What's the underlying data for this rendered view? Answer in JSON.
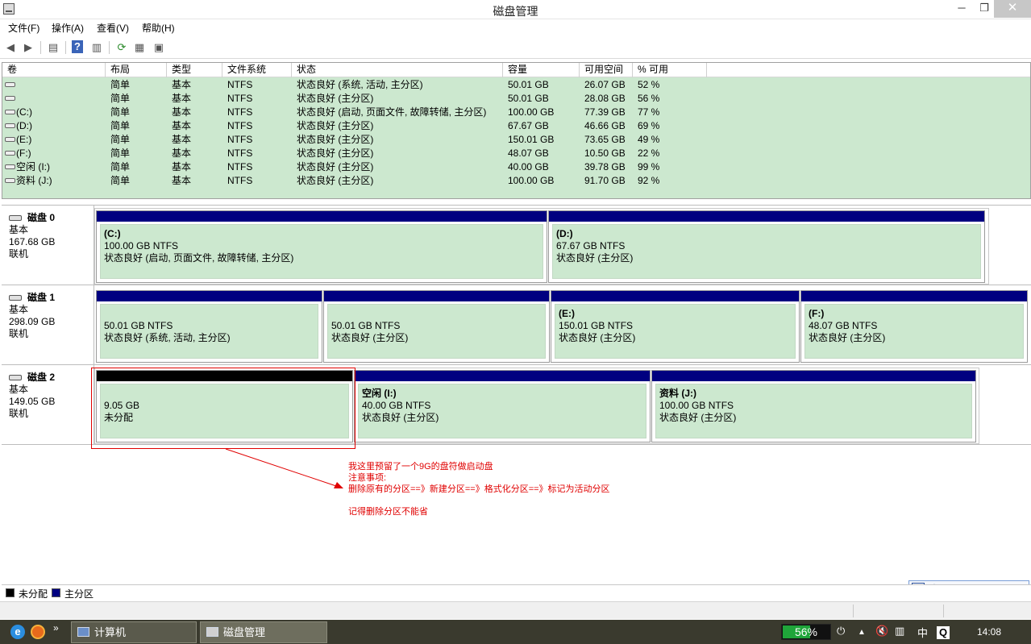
{
  "window": {
    "title": "磁盘管理"
  },
  "menu": [
    "文件(F)",
    "操作(A)",
    "查看(V)",
    "帮助(H)"
  ],
  "toolbar": {
    "buttons": [
      "back-icon",
      "forward-icon",
      "show-hide-console-tree-icon",
      "help-icon",
      "show-hide-action-pane-icon",
      "refresh-icon",
      "properties-icon",
      "rescan-disks-icon"
    ]
  },
  "volume_list": {
    "columns": [
      "卷",
      "布局",
      "类型",
      "文件系统",
      "状态",
      "容量",
      "可用空间",
      "% 可用"
    ],
    "rows": [
      [
        "",
        "简单",
        "基本",
        "NTFS",
        "状态良好 (系统, 活动, 主分区)",
        "50.01 GB",
        "26.07 GB",
        "52 %"
      ],
      [
        "",
        "简单",
        "基本",
        "NTFS",
        "状态良好 (主分区)",
        "50.01 GB",
        "28.08 GB",
        "56 %"
      ],
      [
        "(C:)",
        "简单",
        "基本",
        "NTFS",
        "状态良好 (启动, 页面文件, 故障转储, 主分区)",
        "100.00 GB",
        "77.39 GB",
        "77 %"
      ],
      [
        "(D:)",
        "简单",
        "基本",
        "NTFS",
        "状态良好 (主分区)",
        "67.67 GB",
        "46.66 GB",
        "69 %"
      ],
      [
        "(E:)",
        "简单",
        "基本",
        "NTFS",
        "状态良好 (主分区)",
        "150.01 GB",
        "73.65 GB",
        "49 %"
      ],
      [
        "(F:)",
        "简单",
        "基本",
        "NTFS",
        "状态良好 (主分区)",
        "48.07 GB",
        "10.50 GB",
        "22 %"
      ],
      [
        "空闲 (I:)",
        "简单",
        "基本",
        "NTFS",
        "状态良好 (主分区)",
        "40.00 GB",
        "39.78 GB",
        "99 %"
      ],
      [
        "资料 (J:)",
        "简单",
        "基本",
        "NTFS",
        "状态良好 (主分区)",
        "100.00 GB",
        "91.70 GB",
        "92 %"
      ]
    ]
  },
  "disks": [
    {
      "name": "磁盘 0",
      "type": "基本",
      "size": "167.68 GB",
      "status": "联机",
      "partitions": [
        {
          "name": "(C:)",
          "size": "100.00 GB NTFS",
          "status": "状态良好 (启动, 页面文件, 故障转储, 主分区)",
          "kind": "primary"
        },
        {
          "name": "(D:)",
          "size": "67.67 GB NTFS",
          "status": "状态良好 (主分区)",
          "kind": "primary"
        }
      ]
    },
    {
      "name": "磁盘 1",
      "type": "基本",
      "size": "298.09 GB",
      "status": "联机",
      "partitions": [
        {
          "name": "",
          "size": "50.01 GB NTFS",
          "status": "状态良好 (系统, 活动, 主分区)",
          "kind": "primary"
        },
        {
          "name": "",
          "size": "50.01 GB NTFS",
          "status": "状态良好 (主分区)",
          "kind": "primary"
        },
        {
          "name": "(E:)",
          "size": "150.01 GB NTFS",
          "status": "状态良好 (主分区)",
          "kind": "primary"
        },
        {
          "name": "(F:)",
          "size": "48.07 GB NTFS",
          "status": "状态良好 (主分区)",
          "kind": "primary"
        }
      ]
    },
    {
      "name": "磁盘 2",
      "type": "基本",
      "size": "149.05 GB",
      "status": "联机",
      "partitions": [
        {
          "name": "",
          "size": "9.05 GB",
          "status": "未分配",
          "kind": "unallocated"
        },
        {
          "name": "空闲  (I:)",
          "size": "40.00 GB NTFS",
          "status": "状态良好 (主分区)",
          "kind": "primary"
        },
        {
          "name": "资料  (J:)",
          "size": "100.00 GB NTFS",
          "status": "状态良好 (主分区)",
          "kind": "primary"
        }
      ]
    }
  ],
  "annotation": [
    "我这里预留了一个9G的盘符做启动盘",
    "注意事项:",
    "删除原有的分区==》新建分区==》格式化分区==》标记为活动分区",
    "",
    "记得删除分区不能省"
  ],
  "legend": [
    {
      "label": "未分配",
      "color": "#000000"
    },
    {
      "label": "主分区",
      "color": "#000080"
    }
  ],
  "ime_bar": {
    "items": [
      "中",
      "☽",
      "°,",
      "⌨",
      "⁝",
      "🔧"
    ]
  },
  "taskbar": {
    "buttons": [
      "计算机",
      "磁盘管理"
    ],
    "battery_percent": "56%",
    "battery_level": 0.56,
    "ime_indicator": "中",
    "clock": "14:08"
  },
  "colors": {
    "primary_partition": "#000080",
    "unallocated": "#000000",
    "partition_fill": "#cce8cf",
    "annotation": "#e00000"
  }
}
